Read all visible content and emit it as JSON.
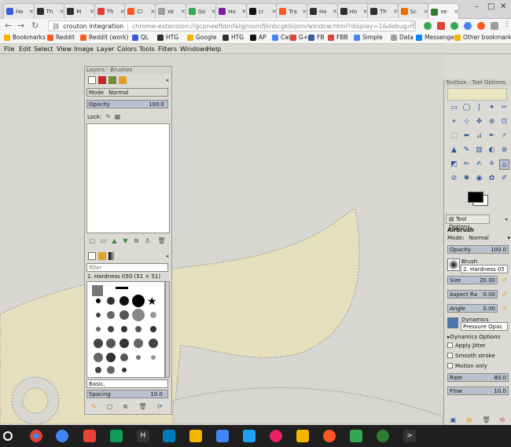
{
  "browser": {
    "tabs": [
      {
        "title": "Ho",
        "favicon": "v-icon",
        "color": "#3b5bdb"
      },
      {
        "title": "Th",
        "favicon": "htg-icon",
        "color": "#2f2f2f"
      },
      {
        "title": "M",
        "favicon": "htg-icon",
        "color": "#2f2f2f"
      },
      {
        "title": "Th",
        "favicon": "chrome-icon",
        "color": "#e53935"
      },
      {
        "title": "Cl",
        "favicon": "reddit-icon",
        "color": "#ff5722"
      },
      {
        "title": "xk",
        "favicon": "xkcd-icon",
        "color": "#9e9e9e"
      },
      {
        "title": "Go",
        "favicon": "play-icon",
        "color": "#34a853"
      },
      {
        "title": "Ho",
        "favicon": "v-icon",
        "color": "#7b1fa2"
      },
      {
        "title": "cr",
        "favicon": "github-icon",
        "color": "#111111"
      },
      {
        "title": "Tra",
        "favicon": "reddit-icon",
        "color": "#ff5722"
      },
      {
        "title": "Ho",
        "favicon": "htg-icon",
        "color": "#2f2f2f"
      },
      {
        "title": "Ho",
        "favicon": "htg-icon",
        "color": "#2f2f2f"
      },
      {
        "title": "Th",
        "favicon": "htg-icon",
        "color": "#2f2f2f"
      },
      {
        "title": "Sc",
        "favicon": "orange-icon",
        "color": "#ef6c00"
      },
      {
        "title": "xe",
        "favicon": "crouton-icon",
        "color": "#2e7d32",
        "active": true
      }
    ],
    "omnibox": {
      "site": "crouton integration",
      "url": "chrome-extension://gcpneefbbnfalgjniomfjknbcgkbijom/window.html?display=1&debug=0&hidpi=0&title=xenial&..."
    },
    "bookmarks": [
      {
        "label": "Bookmarks",
        "color": "#f4b400"
      },
      {
        "label": "Reddit",
        "color": "#ff5722"
      },
      {
        "label": "Reddit (work)",
        "color": "#ff5722"
      },
      {
        "label": "QL",
        "color": "#3b5bdb"
      },
      {
        "label": "HTG",
        "color": "#2f2f2f"
      },
      {
        "label": "Google",
        "color": "#f4b400"
      },
      {
        "label": "HTG",
        "color": "#2f2f2f"
      },
      {
        "label": "AP",
        "color": "#111111"
      },
      {
        "label": "Cal",
        "color": "#4285f4"
      },
      {
        "label": "G+",
        "color": "#db4437"
      },
      {
        "label": "FB",
        "color": "#3b5998"
      },
      {
        "label": "FBB",
        "color": "#db4437"
      },
      {
        "label": "Simple",
        "color": "#4285f4"
      },
      {
        "label": "Data",
        "color": "#9e9e9e"
      },
      {
        "label": "Messenger",
        "color": "#0084ff"
      }
    ],
    "other_bookmarks": "Other bookmarks"
  },
  "gimp": {
    "menu": [
      "File",
      "Edit",
      "Select",
      "View",
      "Image",
      "Layer",
      "Colors",
      "Tools",
      "Filters",
      "Windows",
      "Help"
    ],
    "layers_dock": {
      "title": "Layers - Brushes",
      "mode_label": "Mode",
      "mode_value": "Normal",
      "opacity_label": "Opacity",
      "opacity_value": "100.0",
      "lock_label": "Lock:",
      "brush_filter": "filter",
      "brush_name": "2. Hardness 050 (51 × 51)",
      "brush_tag": "Basic,",
      "spacing_label": "Spacing",
      "spacing_value": "10.0"
    },
    "toolbox": {
      "title": "Toolbox - Tool Options",
      "tab_label": "Tool Options",
      "tool_name": "Airbrush",
      "mode_label": "Mode:",
      "mode_value": "Normal",
      "opacity_label": "Opacity",
      "opacity_value": "100.0",
      "brush_label": "Brush",
      "brush_value": "2. Hardness 05",
      "size_label": "Size",
      "size_value": "20.00",
      "aspect_label": "Aspect Ra",
      "aspect_value": "0.00",
      "angle_label": "Angle",
      "angle_value": "0.00",
      "dynamics_label": "Dynamics",
      "dynamics_value": "Pressure Opac",
      "dynamics_options": "Dynamics Options",
      "apply_jitter": "Apply Jitter",
      "smooth_stroke": "Smooth stroke",
      "motion_only": "Motion only",
      "rate_label": "Rate",
      "rate_value": "80.0",
      "flow_label": "Flow",
      "flow_value": "10.0"
    }
  },
  "colors": {
    "shape_fill": "#e6dfbd",
    "canvas_bg": "#d7d6d1"
  }
}
